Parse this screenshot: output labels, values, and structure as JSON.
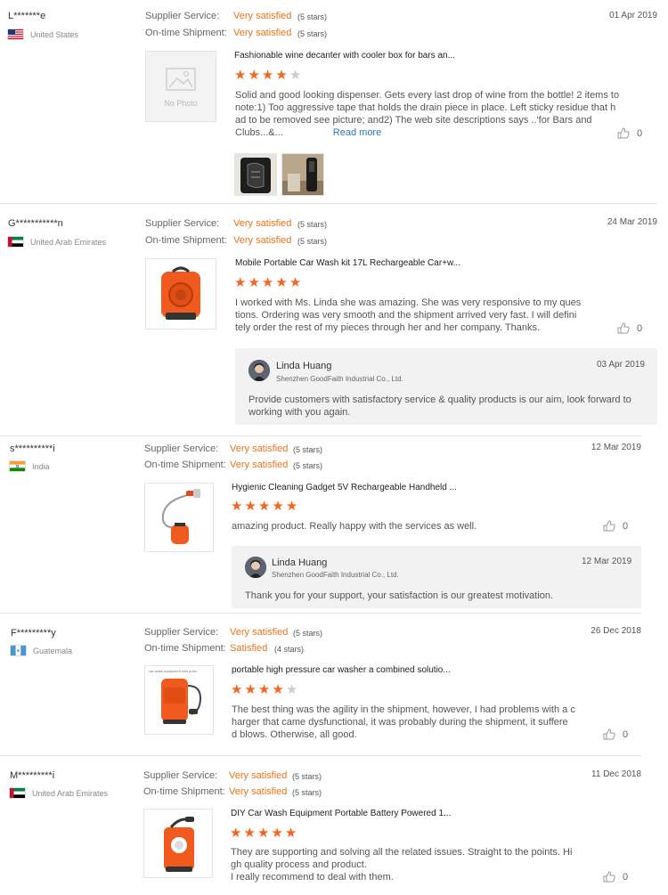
{
  "labels": {
    "supplier_service": "Supplier Service:",
    "ontime_shipment": "On-time Shipment:",
    "read_more": "Read more"
  },
  "colors": {
    "accent": "#e8741c",
    "star": "#f26522",
    "link": "#2d76b8"
  },
  "reviews": [
    {
      "user": "L*******e",
      "country": "United States",
      "flag": "us",
      "supplier_value": "Very satisfied",
      "supplier_stars": "(5 stars)",
      "shipment_value": "Very satisfied",
      "shipment_stars": "(5 stars)",
      "date": "01 Apr 2019",
      "thumb_text": "No Photo",
      "title": "Fashionable wine decanter with cooler box for bars an...",
      "rating": 4,
      "text": "Solid and good looking dispenser. Gets every last drop of wine from the bottle! 2 items to\nnote:1) Too aggressive tape that holds the drain piece in place. Left sticky residue that h\nad to be removed see picture; and2) The web site descriptions says ..'for Bars and\nClubs...&...",
      "likes": "0"
    },
    {
      "user": "G***********n",
      "country": "United Arab Emirates",
      "flag": "ae",
      "supplier_value": "Very satisfied",
      "supplier_stars": "(5 stars)",
      "shipment_value": "Very satisfied",
      "shipment_stars": "(5 stars)",
      "date": "24 Mar 2019",
      "title": "Mobile Portable Car Wash kit 17L Rechargeable Car+w...",
      "rating": 5,
      "text": "I worked with Ms. Linda she was amazing. She was very responsive to my ques\ntions. Ordering was very smooth and the shipment arrived very fast. I will defini\ntely order the rest of my pieces through her and her company. Thanks.",
      "likes": "0",
      "reply": {
        "name": "Linda Huang",
        "company": "Shenzhen GoodFaith Industrial Co., Ltd.",
        "date": "03 Apr 2019",
        "text": "Provide customers with satisfactory service & quality products is our aim, look forward to\nworking with you again."
      }
    },
    {
      "user": "s**********i",
      "country": "India",
      "flag": "in",
      "supplier_value": "Very satisfied",
      "supplier_stars": "(5 stars)",
      "shipment_value": "Very satisfied",
      "shipment_stars": "(5 stars)",
      "date": "12 Mar 2019",
      "title": "Hygienic Cleaning Gadget 5V Rechargeable Handheld ...",
      "rating": 5,
      "text": "amazing product. Really happy with the services as well.",
      "likes": "0",
      "reply": {
        "name": "Linda Huang",
        "company": "Shenzhen GoodFaith Industrial Co., Ltd.",
        "date": "12 Mar 2019",
        "text": "Thank you for your support,  your satisfaction is our greatest motivation."
      }
    },
    {
      "user": "F*********y",
      "country": "Guatemala",
      "flag": "gt",
      "supplier_value": "Very satisfied",
      "supplier_stars": "(5 stars)",
      "shipment_value": "Satisfied",
      "shipment_stars": "(4 stars)",
      "date": "26 Dec 2018",
      "thumb_caption": "car wash equipment with price",
      "title": "portable high pressure car washer a combined solutio...",
      "rating": 4,
      "text": "The best thing was the agility in the shipment, however, I had problems with a c\nharger that came dysfunctional, it was probably during the shipment, it suffere\nd blows. Otherwise, all good.",
      "likes": "0"
    },
    {
      "user": "M*********i",
      "country": "United Arab Emirates",
      "flag": "ae",
      "supplier_value": "Very satisfied",
      "supplier_stars": "(5 stars)",
      "shipment_value": "Very satisfied",
      "shipment_stars": "(5 stars)",
      "date": "11 Dec 2018",
      "title": "DIY Car Wash Equipment Portable Battery Powered 1...",
      "rating": 5,
      "text": "They are supporting and solving all the related issues. Straight to the points. Hi\ngh quality process and product.\nI really recommend to deal with them.",
      "likes": "0"
    }
  ]
}
